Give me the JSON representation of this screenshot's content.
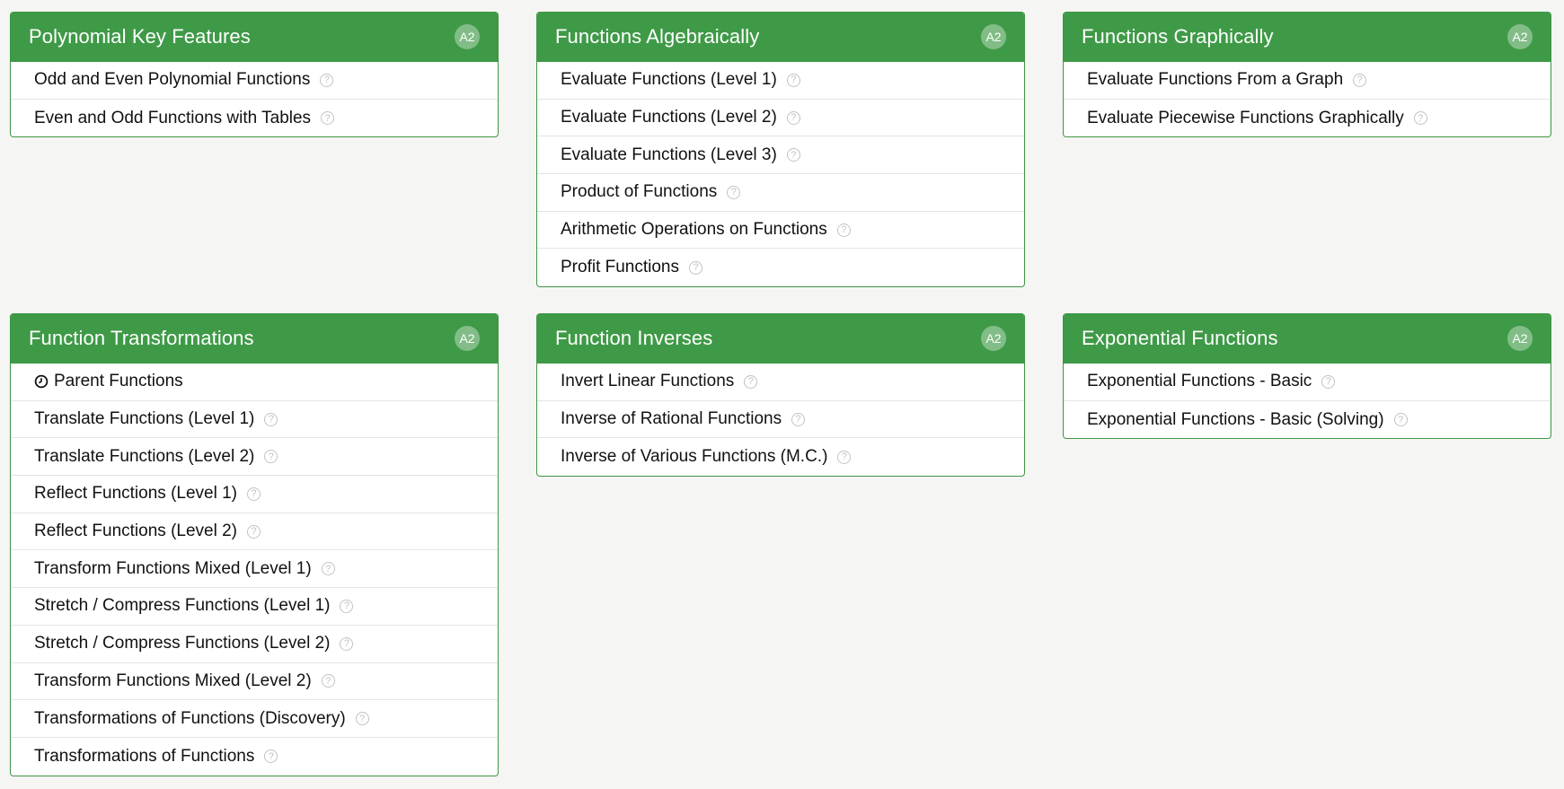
{
  "badge_label": "A2",
  "help_glyph": "?",
  "cards": [
    {
      "title": "Polynomial Key Features",
      "items": [
        "Odd and Even Polynomial Functions",
        "Even and Odd Functions with Tables"
      ]
    },
    {
      "title": "Functions Algebraically",
      "items": [
        "Evaluate Functions (Level 1)",
        "Evaluate Functions (Level 2)",
        "Evaluate Functions (Level 3)",
        "Product of Functions",
        "Arithmetic Operations on Functions",
        "Profit Functions"
      ]
    },
    {
      "title": "Functions Graphically",
      "items": [
        "Evaluate Functions From a Graph",
        "Evaluate Piecewise Functions Graphically"
      ]
    },
    {
      "title": "Function Transformations",
      "items": [
        "Parent Functions",
        "Translate Functions (Level 1)",
        "Translate Functions (Level 2)",
        "Reflect Functions (Level 1)",
        "Reflect Functions (Level 2)",
        "Transform Functions Mixed (Level 1)",
        "Stretch / Compress Functions (Level 1)",
        "Stretch / Compress Functions (Level 2)",
        "Transform Functions Mixed (Level 2)",
        "Transformations of Functions (Discovery)",
        "Transformations of Functions"
      ]
    },
    {
      "title": "Function Inverses",
      "items": [
        "Invert Linear Functions",
        "Inverse of Rational Functions",
        "Inverse of Various Functions (M.C.)"
      ]
    },
    {
      "title": "Exponential Functions",
      "items": [
        "Exponential Functions - Basic",
        "Exponential Functions - Basic (Solving)"
      ]
    }
  ],
  "colors": {
    "header_green": "#3f9a47",
    "background": "#f5f5f4"
  },
  "icons": {
    "help": "question-circle-icon",
    "timed": "clock-icon"
  }
}
